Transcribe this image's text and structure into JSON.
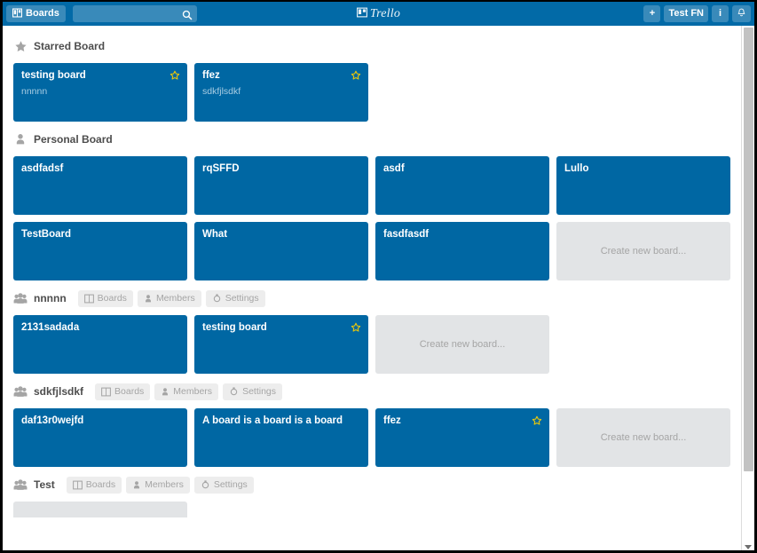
{
  "header": {
    "boards_button": "Boards",
    "boards_icon": "board-icon",
    "search_value": "",
    "search_placeholder": "",
    "search_icon": "search-icon",
    "logo_text": "Trello",
    "logo_icon": "trello-logo-icon",
    "add_button": "+",
    "user_button": "Test FN",
    "info_button": "i",
    "notification_icon": "bell-icon",
    "bg_color": "#026aa7"
  },
  "colors": {
    "board_tile": "#0067a3",
    "create_tile": "#e2e4e6",
    "star_active": "#e6c60d",
    "org_button_bg": "#ededed",
    "page_bg": "#ffffff"
  },
  "org_actions": {
    "boards": "Boards",
    "members": "Members",
    "settings": "Settings"
  },
  "create_new_board_label": "Create new board...",
  "sections": [
    {
      "id": "starred",
      "icon": "star-icon",
      "title": "Starred Board",
      "type": "starred",
      "has_org_buttons": false,
      "has_create_tile": false,
      "boards": [
        {
          "name": "testing board",
          "org": "nnnnn",
          "starred": true
        },
        {
          "name": "ffez",
          "org": "sdkfjlsdkf",
          "starred": true
        }
      ]
    },
    {
      "id": "personal",
      "icon": "person-icon",
      "title": "Personal Board",
      "type": "personal",
      "has_org_buttons": false,
      "has_create_tile": true,
      "boards": [
        {
          "name": "asdfadsf",
          "org": "",
          "starred": false
        },
        {
          "name": "rqSFFD",
          "org": "",
          "starred": false
        },
        {
          "name": "asdf",
          "org": "",
          "starred": false
        },
        {
          "name": "Lullo",
          "org": "",
          "starred": false
        },
        {
          "name": "TestBoard",
          "org": "",
          "starred": false
        },
        {
          "name": "What",
          "org": "",
          "starred": false
        },
        {
          "name": "fasdfasdf",
          "org": "",
          "starred": false
        }
      ]
    },
    {
      "id": "nnnnn",
      "icon": "people-icon",
      "title": "nnnnn",
      "type": "organization",
      "has_org_buttons": true,
      "has_create_tile": true,
      "boards": [
        {
          "name": "2131sadada",
          "org": "",
          "starred": false
        },
        {
          "name": "testing board",
          "org": "",
          "starred": true
        }
      ]
    },
    {
      "id": "sdkfjlsdkf",
      "icon": "people-icon",
      "title": "sdkfjlsdkf",
      "type": "organization",
      "has_org_buttons": true,
      "has_create_tile": true,
      "boards": [
        {
          "name": "daf13r0wejfd",
          "org": "",
          "starred": false
        },
        {
          "name": "A board is a board is a board",
          "org": "",
          "starred": false
        },
        {
          "name": "ffez",
          "org": "",
          "starred": true
        }
      ]
    },
    {
      "id": "test",
      "icon": "people-icon",
      "title": "Test",
      "type": "organization",
      "has_org_buttons": true,
      "has_create_tile": true,
      "clipped": true,
      "boards": [
        {
          "name": "",
          "org": "",
          "starred": false
        }
      ]
    }
  ]
}
